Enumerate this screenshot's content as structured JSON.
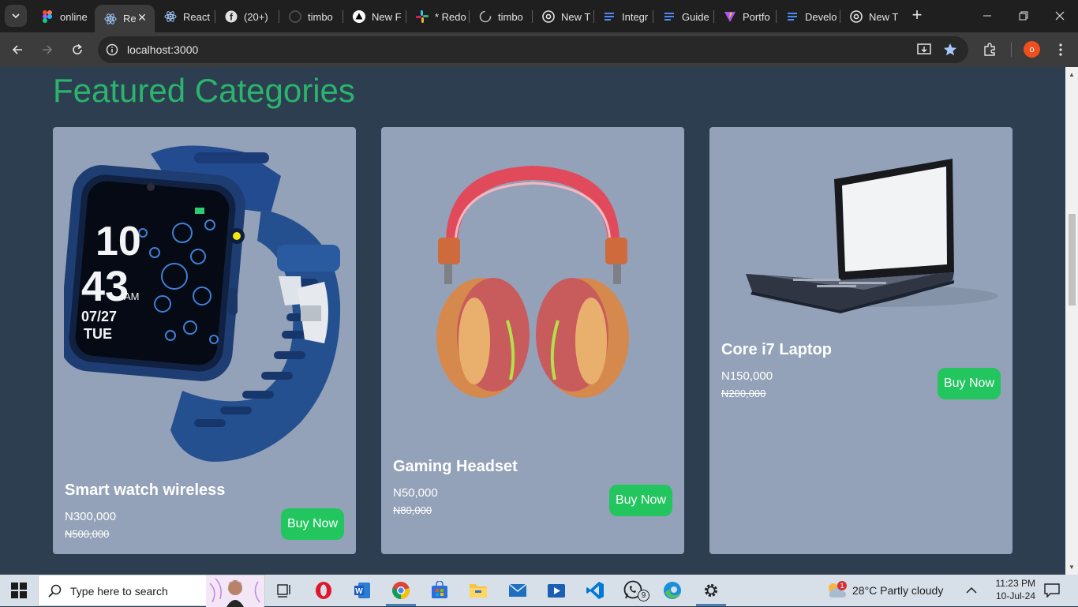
{
  "browser": {
    "tabs": [
      {
        "label": "online",
        "icon": "figma-icon"
      },
      {
        "label": "Re",
        "icon": "react-icon",
        "active": true
      },
      {
        "label": "React",
        "icon": "react-icon"
      },
      {
        "label": "(20+)",
        "icon": "facebook-icon"
      },
      {
        "label": "timbo",
        "icon": "github-icon"
      },
      {
        "label": "New F",
        "icon": "vercel-icon"
      },
      {
        "label": "* Redo",
        "icon": "slack-icon"
      },
      {
        "label": "timbo",
        "icon": "loading-icon"
      },
      {
        "label": "New T",
        "icon": "chrome-icon"
      },
      {
        "label": "Integr",
        "icon": "docs-icon"
      },
      {
        "label": "Guide",
        "icon": "docs-icon"
      },
      {
        "label": "Portfo",
        "icon": "vite-icon"
      },
      {
        "label": "Develo",
        "icon": "docs-icon"
      },
      {
        "label": "New T",
        "icon": "chrome-icon"
      }
    ],
    "url": "localhost:3000",
    "profile_initial": "o"
  },
  "page": {
    "section_title": "Featured Categories",
    "products": [
      {
        "name": "Smart watch wireless",
        "price": "N300,000",
        "old_price": "N500,000",
        "button": "Buy Now",
        "watch_time_h": "10",
        "watch_time_m": "43",
        "watch_ampm": "AM",
        "watch_date": "07/27",
        "watch_day": "TUE"
      },
      {
        "name": "Gaming Headset",
        "price": "N50,000",
        "old_price": "N80,000",
        "button": "Buy Now"
      },
      {
        "name": "Core i7 Laptop",
        "price": "N150,000",
        "old_price": "N200,000",
        "button": "Buy Now"
      }
    ]
  },
  "taskbar": {
    "search_placeholder": "Type here to search",
    "whatsapp_badge": "9",
    "weather_badge": "1",
    "weather": "28°C  Partly cloudy",
    "time": "11:23 PM",
    "date": "10-Jul-24"
  },
  "colors": {
    "accent_green": "#22c55e",
    "title_green": "#2ab46d",
    "page_bg": "#2d3e50",
    "card_bg": "#93a2b8"
  }
}
